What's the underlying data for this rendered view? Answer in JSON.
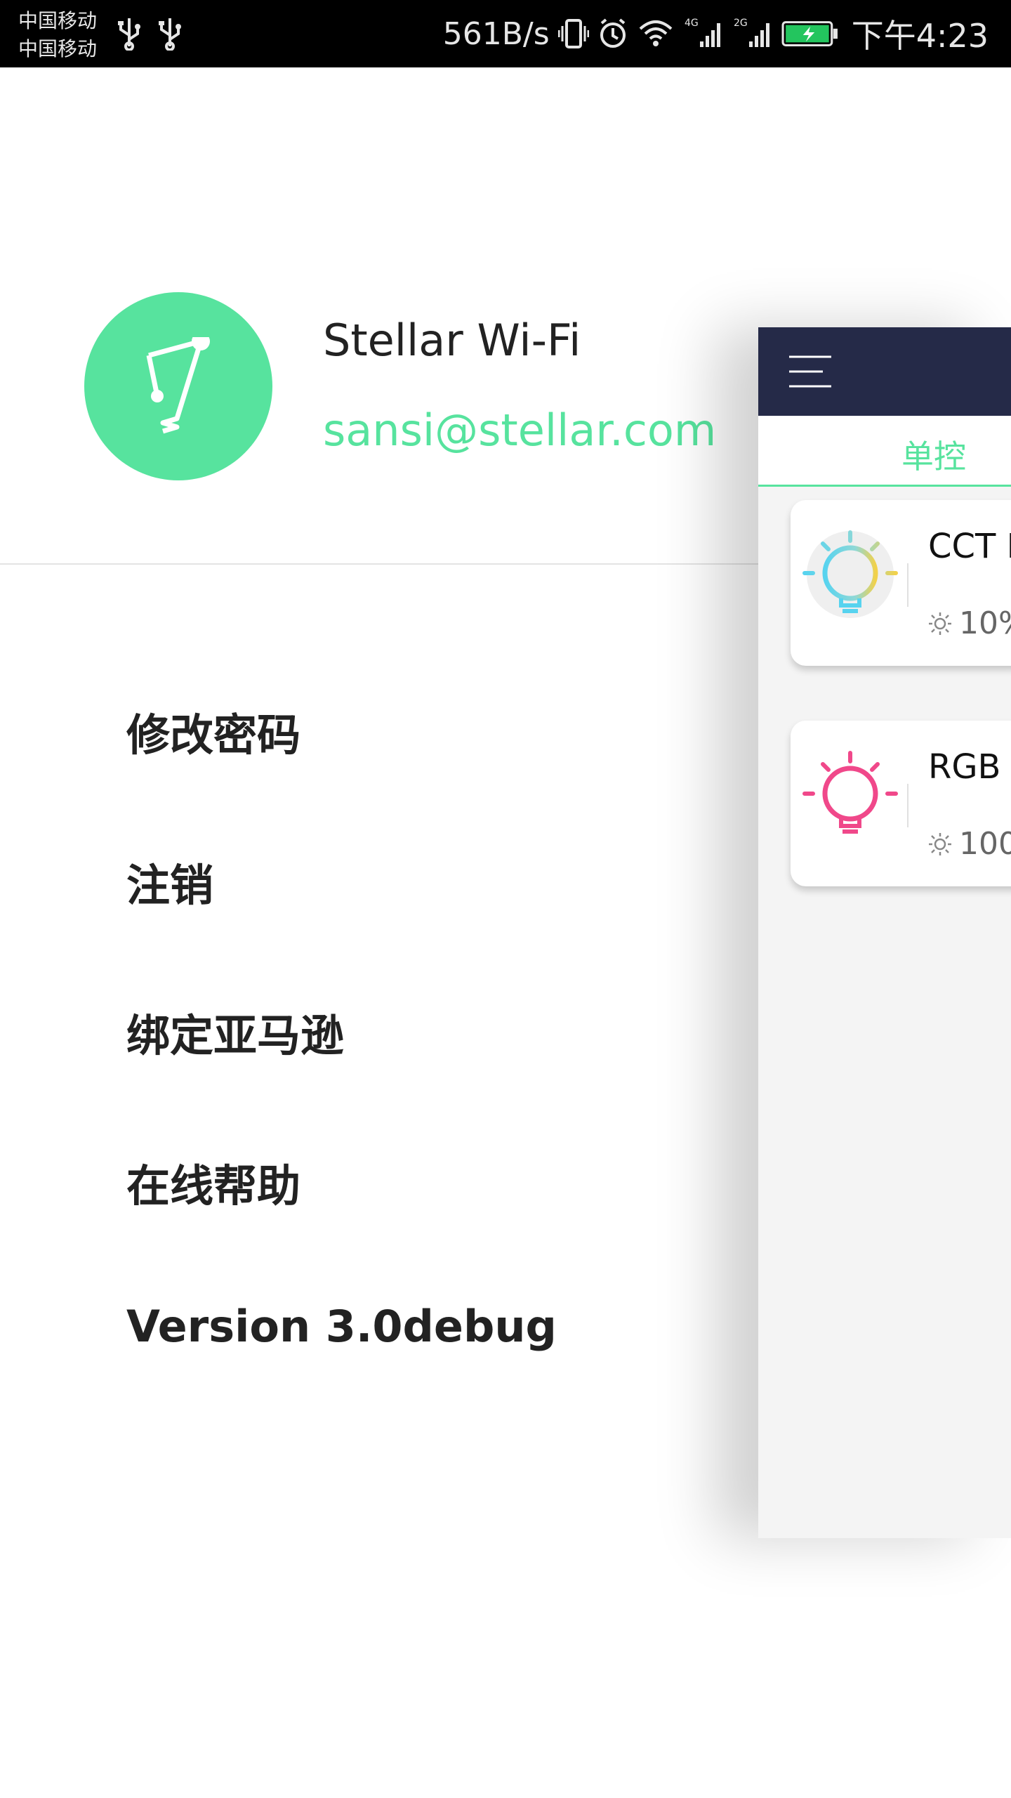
{
  "status_bar": {
    "carrier_1": "中国移动",
    "carrier_2": "中国移动",
    "net_speed": "561B/s",
    "time": "下午4:23",
    "icons": [
      "usb-icon",
      "usb-icon",
      "vibrate-icon",
      "alarm-icon",
      "wifi-icon",
      "signal-4g-icon",
      "signal-2g-icon",
      "battery-charging-icon"
    ]
  },
  "drawer": {
    "avatar_icon": "stellar-logo-icon",
    "account": {
      "name": "Stellar Wi-Fi",
      "email": "sansi@stellar.com"
    },
    "menu": [
      {
        "label": "修改密码"
      },
      {
        "label": "注销"
      },
      {
        "label": "绑定亚马逊"
      },
      {
        "label": "在线帮助"
      },
      {
        "label": "Version 3.0debug"
      }
    ]
  },
  "main_screen": {
    "menu_icon": "hamburger-menu-icon",
    "active_tab": "单控",
    "devices": [
      {
        "title": "CCT B",
        "brightness": "10%",
        "icon": "cct-bulb-icon"
      },
      {
        "title": "RGB B",
        "brightness": "100",
        "icon": "rgb-bulb-icon"
      }
    ]
  },
  "colors": {
    "accent": "#57e39e",
    "appbar": "#252a48",
    "rgb_bulb": "#f0488a",
    "cct_bulb_warm": "#f2d14a",
    "cct_bulb_cool": "#57d3ef"
  }
}
